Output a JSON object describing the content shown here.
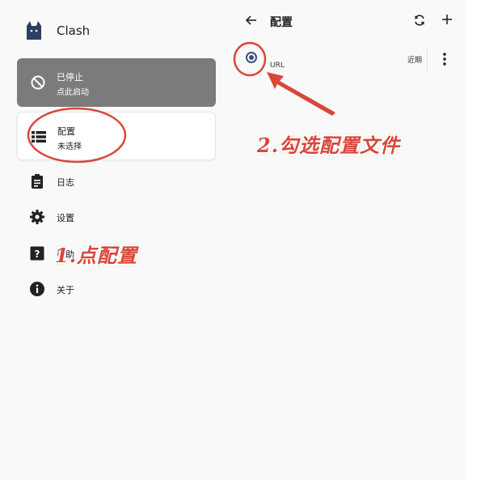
{
  "app": {
    "title": "Clash"
  },
  "status_card": {
    "title": "已停止",
    "subtitle": "点此启动"
  },
  "profile_card": {
    "title": "配置",
    "subtitle": "未选择"
  },
  "menu": [
    {
      "label": "日志",
      "icon": "clipboard-icon"
    },
    {
      "label": "设置",
      "icon": "gear-icon"
    },
    {
      "label": "帮助",
      "icon": "help-icon"
    },
    {
      "label": "关于",
      "icon": "info-icon"
    }
  ],
  "profiles_page": {
    "title": "配置",
    "profile": {
      "name": "URL",
      "updated": "近期",
      "selected": true
    }
  },
  "annotations": {
    "step1": "1.点配置",
    "step2": "2.勾选配置文件",
    "color": "#d9473b"
  },
  "colors": {
    "status_card_bg": "#7b7b7b",
    "radio_accent": "#35507d"
  }
}
